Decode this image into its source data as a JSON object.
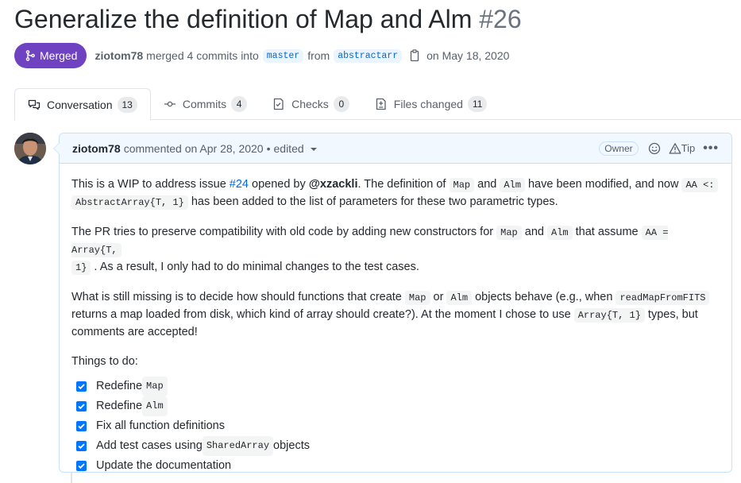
{
  "pr": {
    "title": "Generalize the definition of Map and Alm",
    "number": "#26",
    "state_label": "Merged",
    "author": "ziotom78",
    "merged_text": "merged 4 commits into",
    "base_branch": "master",
    "from_text": "from",
    "head_branch": "abstractarr",
    "date_text": "on May 18, 2020"
  },
  "tabs": [
    {
      "label": "Conversation",
      "count": "13",
      "icon": "comment-discussion-icon",
      "active": true
    },
    {
      "label": "Commits",
      "count": "4",
      "icon": "git-commit-icon",
      "active": false
    },
    {
      "label": "Checks",
      "count": "0",
      "icon": "checklist-icon",
      "active": false
    },
    {
      "label": "Files changed",
      "count": "11",
      "icon": "file-diff-icon",
      "active": false
    }
  ],
  "comment": {
    "author": "ziotom78",
    "action": "commented on Apr 28, 2020",
    "separator": "•",
    "edited": "edited",
    "owner_label": "Owner",
    "tip_label": "Tip",
    "kebab": "•••",
    "p1": {
      "t1": "This is a WIP to address issue ",
      "issue_link": "#24",
      "t2": " opened by ",
      "mention": "@xzackli",
      "t3": ". The definition of ",
      "c1": "Map",
      "t4": " and ",
      "c2": "Alm",
      "t5": " have been modified, and now ",
      "c3a": "AA <:",
      "c3b": "AbstractArray{T, 1}",
      "t6": " has been added to the list of parameters for these two parametric types."
    },
    "p2": {
      "t1": "The PR tries to preserve compatibility with old code by adding new constructors for ",
      "c1": "Map",
      "t2": " and ",
      "c2": "Alm",
      "t3": " that assume ",
      "c3a": "AA = Array{T,",
      "c3b": "1}",
      "t4": " . As a result, I only had to do minimal changes to the test cases."
    },
    "p3": {
      "t1": "What is still missing is to decide how should functions that create ",
      "c1": "Map",
      "t2": " or ",
      "c2": "Alm",
      "t3": " objects behave (e.g., when ",
      "c3": "readMapFromFITS",
      "t4": " returns a map loaded from disk, which kind of array should create?). At the moment I chose to use ",
      "c4": "Array{T, 1}",
      "t5": " types, but comments are accepted!"
    },
    "p4": "Things to do:",
    "tasks": [
      {
        "text": "Redefine ",
        "code": "Map",
        "after": "",
        "checked": true
      },
      {
        "text": "Redefine ",
        "code": "Alm",
        "after": "",
        "checked": true
      },
      {
        "text": "Fix all function definitions",
        "code": "",
        "after": "",
        "checked": true
      },
      {
        "text": "Add test cases using ",
        "code": "SharedArray",
        "after": " objects",
        "checked": true
      },
      {
        "text": "Update the documentation",
        "code": "",
        "after": "",
        "checked": true
      }
    ]
  },
  "colors": {
    "merged_purple": "#6f42c1",
    "link_blue": "#0366d6",
    "header_bg": "#f1f8ff",
    "checkbox_blue": "#0075ff"
  }
}
